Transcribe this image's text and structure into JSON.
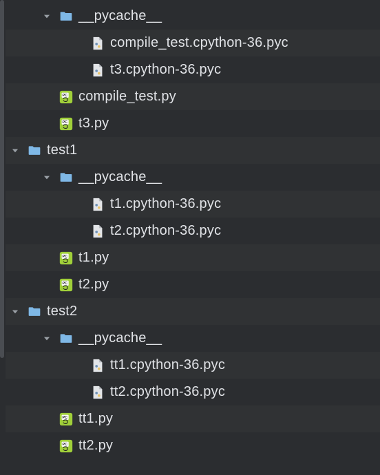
{
  "colors": {
    "folder": "#7fb8e6",
    "chevron": "#9aa0a6",
    "pyicon_bg": "#a0cf3a",
    "pyicon_accent": "#1f1f1f",
    "pyc_bg": "#e3e5e8"
  },
  "tree": [
    {
      "depth": 1,
      "type": "folder",
      "expanded": true,
      "label": "__pycache__"
    },
    {
      "depth": 2,
      "type": "pyc",
      "expanded": null,
      "label": "compile_test.cpython-36.pyc"
    },
    {
      "depth": 2,
      "type": "pyc",
      "expanded": null,
      "label": "t3.cpython-36.pyc"
    },
    {
      "depth": 1,
      "type": "py",
      "expanded": null,
      "label": "compile_test.py"
    },
    {
      "depth": 1,
      "type": "py",
      "expanded": null,
      "label": "t3.py"
    },
    {
      "depth": 0,
      "type": "folder",
      "expanded": true,
      "label": "test1"
    },
    {
      "depth": 1,
      "type": "folder",
      "expanded": true,
      "label": "__pycache__"
    },
    {
      "depth": 2,
      "type": "pyc",
      "expanded": null,
      "label": "t1.cpython-36.pyc"
    },
    {
      "depth": 2,
      "type": "pyc",
      "expanded": null,
      "label": "t2.cpython-36.pyc"
    },
    {
      "depth": 1,
      "type": "py",
      "expanded": null,
      "label": "t1.py"
    },
    {
      "depth": 1,
      "type": "py",
      "expanded": null,
      "label": "t2.py"
    },
    {
      "depth": 0,
      "type": "folder",
      "expanded": true,
      "label": "test2"
    },
    {
      "depth": 1,
      "type": "folder",
      "expanded": true,
      "label": "__pycache__"
    },
    {
      "depth": 2,
      "type": "pyc",
      "expanded": null,
      "label": "tt1.cpython-36.pyc"
    },
    {
      "depth": 2,
      "type": "pyc",
      "expanded": null,
      "label": "tt2.cpython-36.pyc"
    },
    {
      "depth": 1,
      "type": "py",
      "expanded": null,
      "label": "tt1.py"
    },
    {
      "depth": 1,
      "type": "py",
      "expanded": null,
      "label": "tt2.py"
    }
  ]
}
